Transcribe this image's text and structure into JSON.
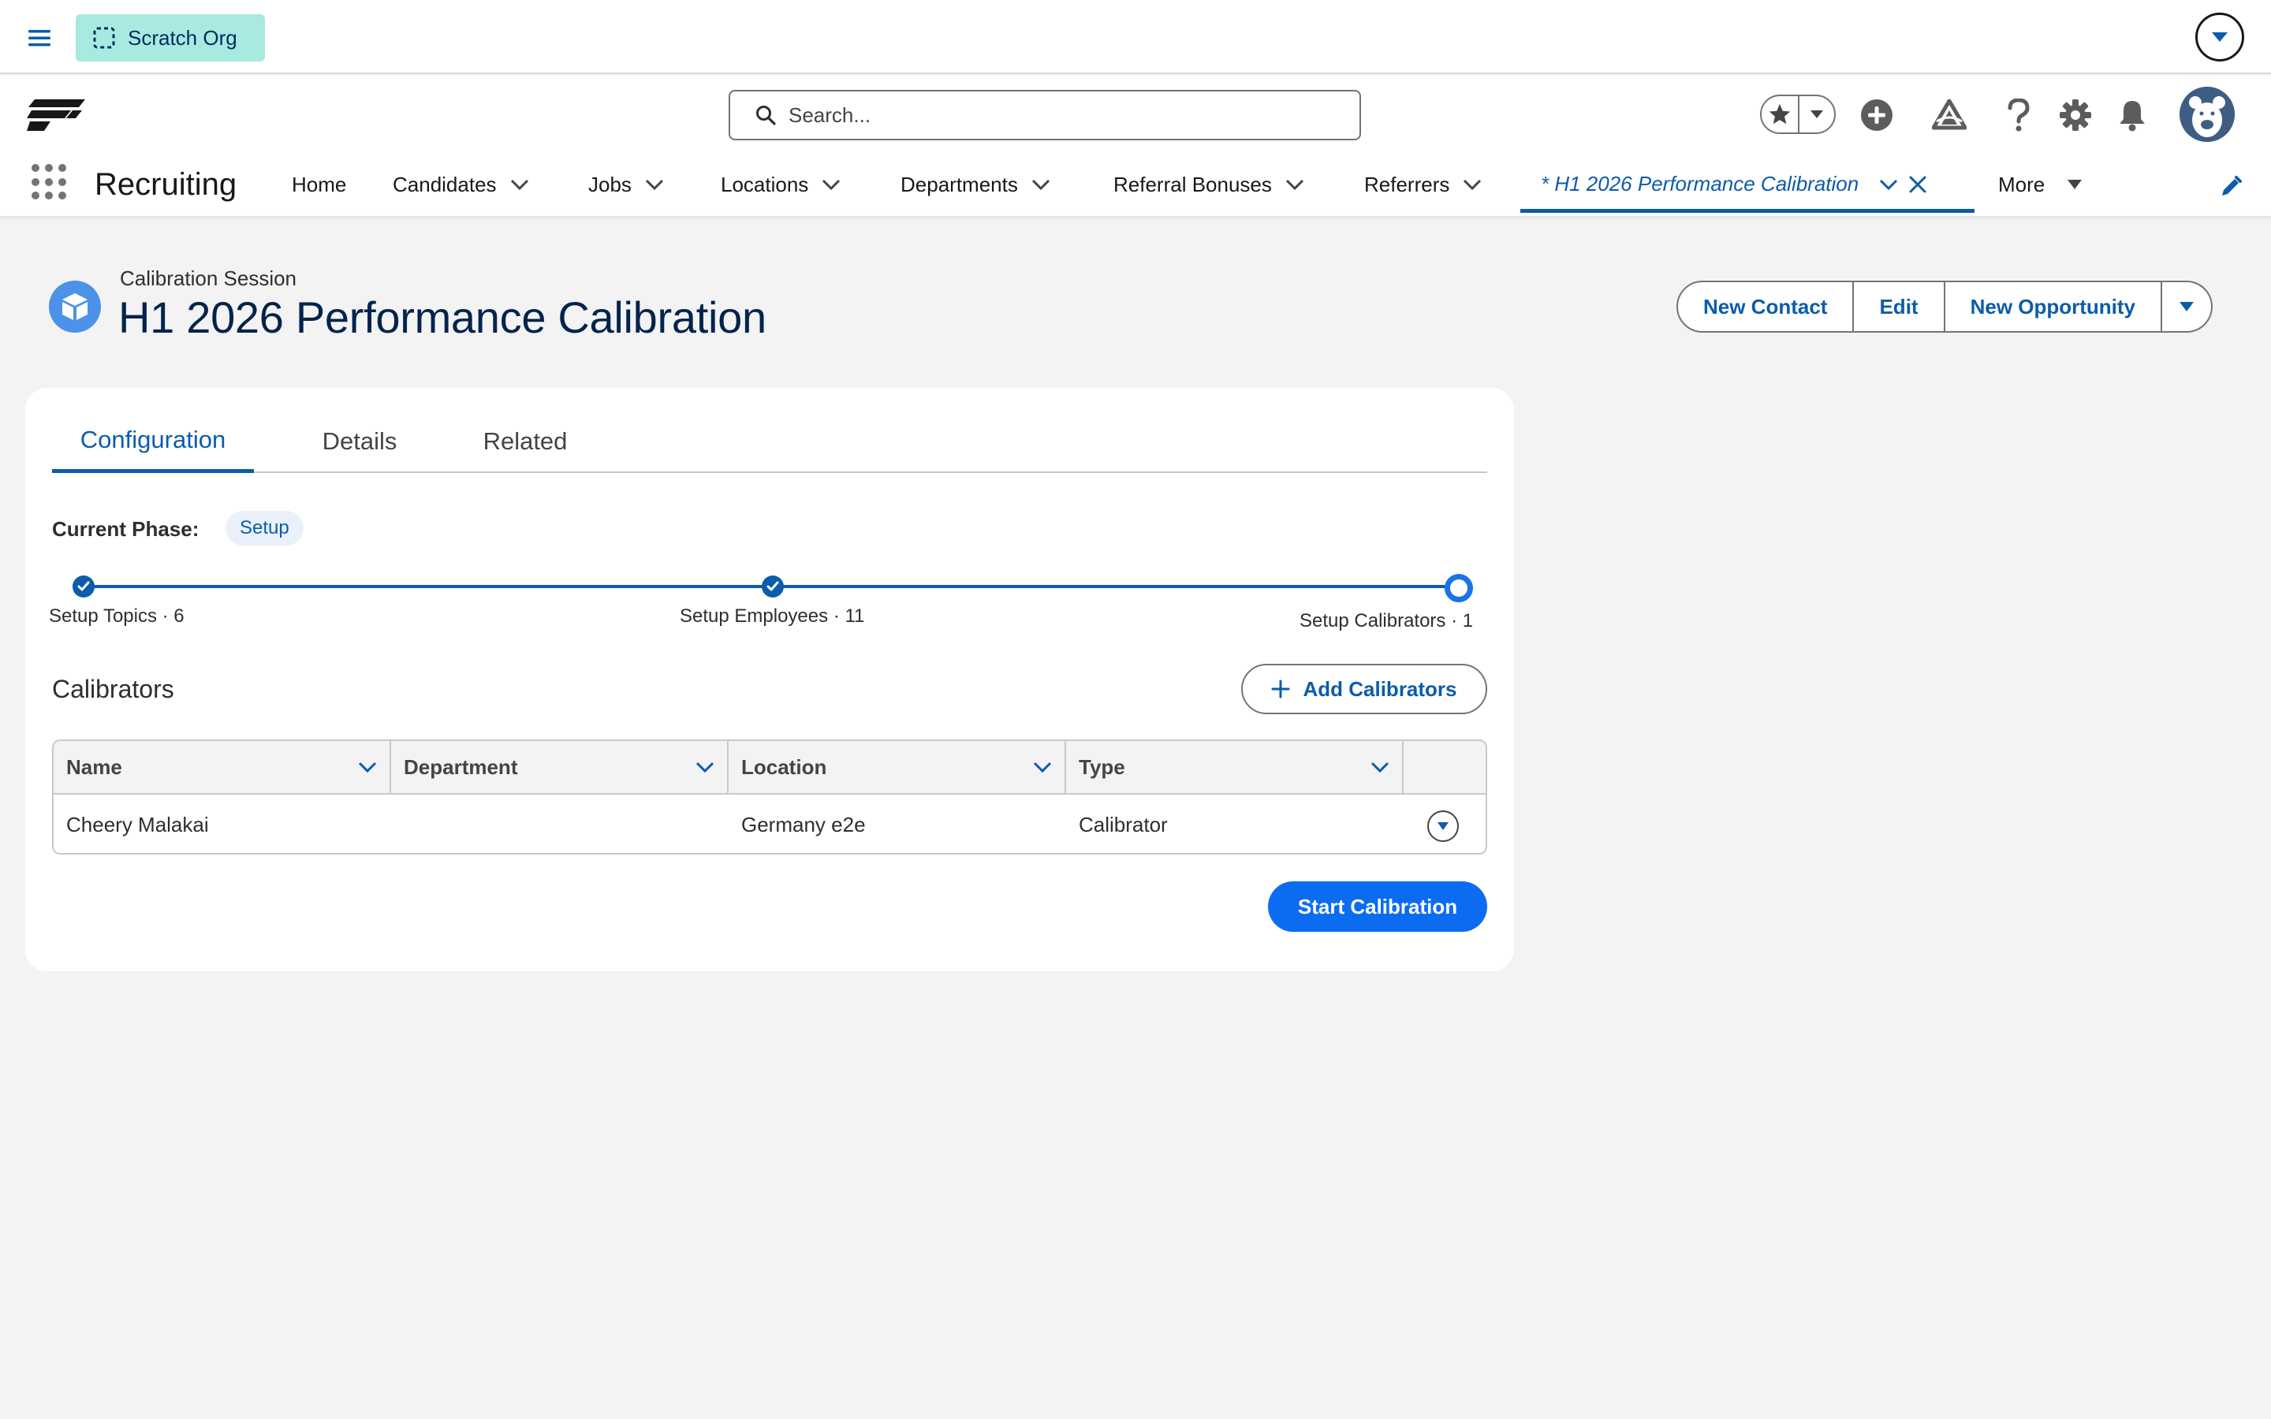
{
  "topbar": {
    "org_label": "Scratch Org"
  },
  "header": {
    "search_placeholder": "Search...",
    "icons": [
      "favorites-star-icon",
      "add-icon",
      "trailhead-icon",
      "help-icon",
      "setup-gear-icon",
      "notification-bell-icon",
      "avatar"
    ]
  },
  "nav": {
    "app_name": "Recruiting",
    "items": [
      {
        "label": "Home"
      },
      {
        "label": "Candidates"
      },
      {
        "label": "Jobs"
      },
      {
        "label": "Locations"
      },
      {
        "label": "Departments"
      },
      {
        "label": "Referral Bonuses"
      },
      {
        "label": "Referrers"
      }
    ],
    "active_tab": "* H1 2026 Performance Calibration",
    "more_label": "More"
  },
  "record": {
    "type": "Calibration Session",
    "title": "H1 2026 Performance Calibration",
    "actions": [
      "New Contact",
      "Edit",
      "New Opportunity"
    ]
  },
  "tabs": {
    "items": [
      "Configuration",
      "Details",
      "Related"
    ],
    "active": "Configuration"
  },
  "phase": {
    "label": "Current Phase:",
    "value": "Setup"
  },
  "stepper": {
    "steps": [
      {
        "label": "Setup Topics · 6",
        "state": "complete"
      },
      {
        "label": "Setup Employees · 11",
        "state": "complete"
      },
      {
        "label": "Setup Calibrators · 1",
        "state": "current"
      }
    ]
  },
  "calibrators": {
    "title": "Calibrators",
    "add_button": "Add Calibrators",
    "columns": [
      "Name",
      "Department",
      "Location",
      "Type"
    ],
    "rows": [
      {
        "name": "Cheery Malakai",
        "department": "",
        "location": "Germany e2e",
        "type": "Calibrator"
      }
    ]
  },
  "footer": {
    "start_button": "Start Calibration"
  },
  "colors": {
    "brand_blue": "#0b5cab",
    "primary_button": "#0b6cf2",
    "scratch_pill": "#a8eadf",
    "record_icon": "#4b92e8"
  }
}
